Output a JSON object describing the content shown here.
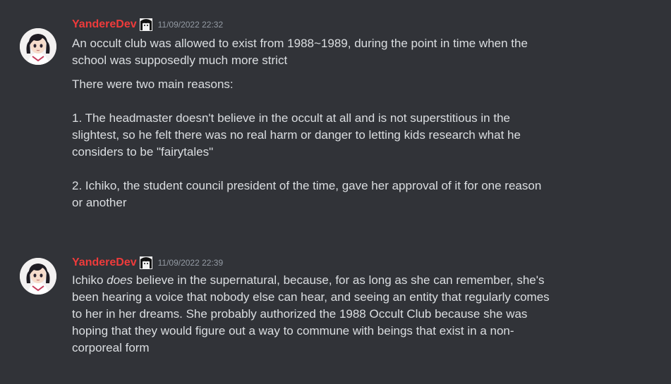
{
  "messages": [
    {
      "username": "YandereDev",
      "timestamp": "11/09/2022 22:32",
      "paragraphs": [
        "An occult club was allowed to exist from 1988~1989, during the point in time when the\nschool was supposedly much more strict",
        "There were two main reasons:\n\n1. The headmaster doesn't believe in the occult at all and is not superstitious in the\nslightest, so he felt there was no real harm or danger to letting kids research what he\nconsiders to be \"fairytales\"\n\n2. Ichiko, the student council president of the time, gave her approval of it for one reason\nor another"
      ]
    },
    {
      "username": "YandereDev",
      "timestamp": "11/09/2022 22:39",
      "text_start": "Ichiko ",
      "text_emphasis": "does",
      "text_rest": " believe in the supernatural, because, for as long as she can remember, she's\nbeen hearing a voice that nobody else can hear, and seeing an entity that regularly comes\nto her in her dreams. She probably authorized the 1988 Occult Club because she was\nhoping that they would figure out a way to commune with beings that exist in a non-\ncorporeal form"
    }
  ],
  "icons": {
    "avatar": "anime-girl-avatar-icon",
    "role": "role-badge-icon"
  },
  "colors": {
    "background": "#313338",
    "username": "#ef3b3b",
    "text": "#dbdee1",
    "timestamp": "#949ba4"
  }
}
